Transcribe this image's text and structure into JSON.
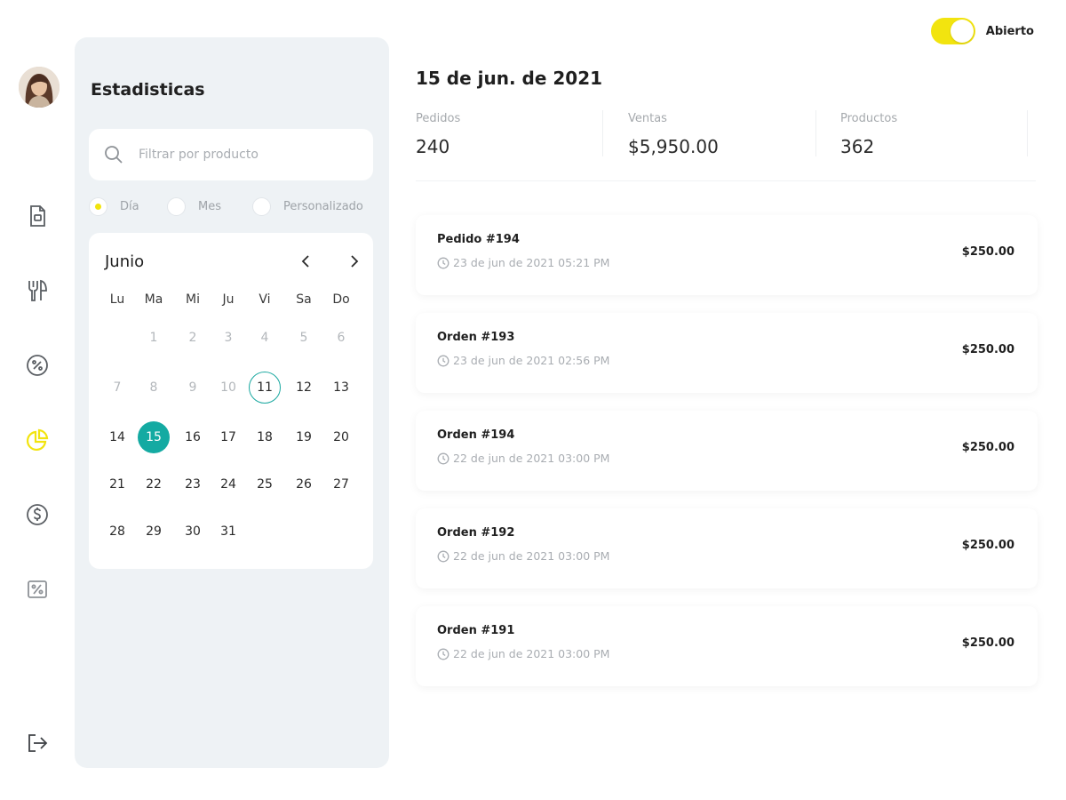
{
  "header": {
    "status_toggle": {
      "label": "Abierto",
      "on": true,
      "color": "#F2E40F"
    }
  },
  "sidebar": {
    "items": [
      {
        "icon": "document-icon",
        "active": false
      },
      {
        "icon": "utensils-icon",
        "active": false
      },
      {
        "icon": "discount-badge-icon",
        "active": false
      },
      {
        "icon": "pie-chart-icon",
        "active": true
      },
      {
        "icon": "dollar-coin-icon",
        "active": false
      },
      {
        "icon": "percent-tag-icon",
        "active": false
      }
    ],
    "logout_icon": "logout-icon",
    "active_color": "#F2E40F"
  },
  "stats_panel": {
    "title": "Estadisticas",
    "search_placeholder": "Filtrar por producto",
    "period_options": [
      {
        "label": "Día",
        "selected": true
      },
      {
        "label": "Mes",
        "selected": false
      },
      {
        "label": "Personalizado",
        "selected": false
      }
    ],
    "calendar": {
      "month": "Junio",
      "weekdays": [
        "Lu",
        "Ma",
        "Mi",
        "Ju",
        "Vi",
        "Sa",
        "Do"
      ],
      "weeks": [
        [
          "",
          "1",
          "2",
          "3",
          "4",
          "5",
          "6"
        ],
        [
          "7",
          "8",
          "9",
          "10",
          "11",
          "12",
          "13"
        ],
        [
          "14",
          "15",
          "16",
          "17",
          "18",
          "19",
          "20"
        ],
        [
          "21",
          "22",
          "23",
          "24",
          "25",
          "26",
          "27"
        ],
        [
          "28",
          "29",
          "30",
          "31",
          "",
          "",
          ""
        ]
      ],
      "today": "11",
      "selected": "15",
      "muted_before": 11,
      "accent_color": "#14AAA2"
    }
  },
  "main": {
    "date_title": "15 de jun. de 2021",
    "stats": [
      {
        "label": "Pedidos",
        "value": "240"
      },
      {
        "label": "Ventas",
        "value": "$5,950.00"
      },
      {
        "label": "Productos",
        "value": "362"
      }
    ],
    "orders": [
      {
        "title": "Pedido #194",
        "time": "23 de jun de 2021 05:21 PM",
        "amount": "$250.00"
      },
      {
        "title": "Orden #193",
        "time": "23 de jun de 2021 02:56 PM",
        "amount": "$250.00"
      },
      {
        "title": "Orden #194",
        "time": "22 de jun de 2021 03:00 PM",
        "amount": "$250.00"
      },
      {
        "title": "Orden #192",
        "time": "22 de jun de 2021 03:00 PM",
        "amount": "$250.00"
      },
      {
        "title": "Orden #191",
        "time": "22 de jun de 2021 03:00 PM",
        "amount": "$250.00"
      }
    ]
  }
}
